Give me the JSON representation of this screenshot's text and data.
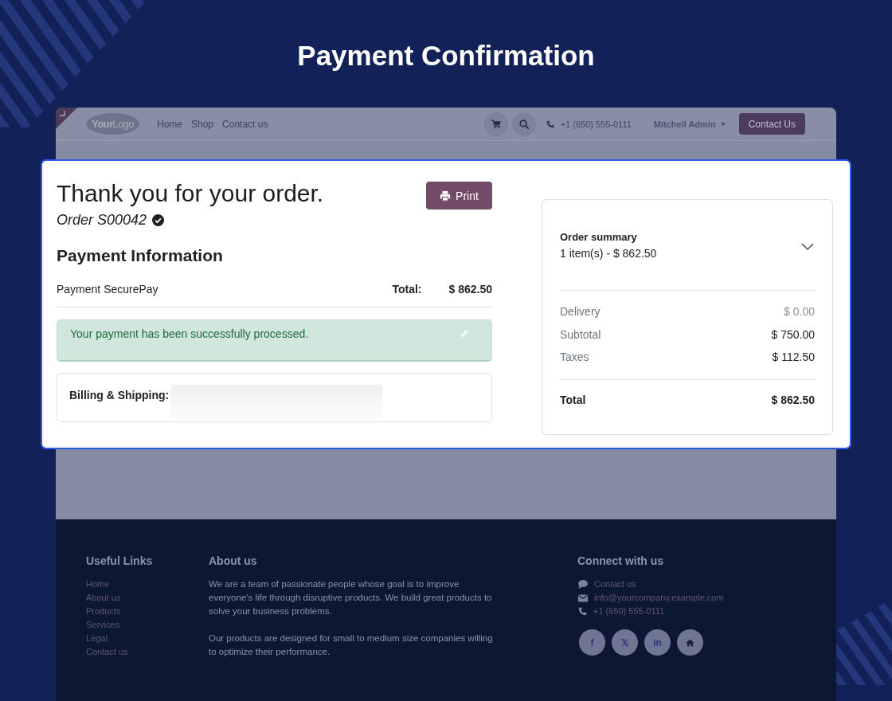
{
  "page": {
    "title": "Payment Confirmation"
  },
  "navbar": {
    "logo": "**Your**Logo",
    "links": [
      "Home",
      "Shop",
      "Contact us"
    ],
    "phone": "+1 (650) 555-0111",
    "user": "Mitchell Admin",
    "cta": "Contact Us"
  },
  "confirmation": {
    "heading": "Thank you for your order.",
    "print_button": "Print",
    "order": "Order S00042",
    "verified": true,
    "section_title": "Payment Information",
    "payment_method": "Payment SecurePay",
    "total_label": "Total:",
    "total_value": "$ 862.50",
    "alert": "Your payment has been successfully processed.",
    "billing_label": "Billing & Shipping:"
  },
  "summary": {
    "title": "Order summary",
    "subtitle": "1 item(s) - $ 862.50",
    "expanded": false,
    "rows": [
      {
        "label": "Delivery",
        "value": "$ 0.00",
        "muted": true
      },
      {
        "label": "Subtotal",
        "value": "$ 750.00",
        "muted": false
      },
      {
        "label": "Taxes",
        "value": "$ 112.50",
        "muted": false
      }
    ],
    "total": {
      "label": "Total",
      "value": "$ 862.50"
    }
  },
  "footer": {
    "links_title": "Useful Links",
    "links": [
      "Home",
      "About us",
      "Products",
      "Services",
      "Legal",
      "Contact us"
    ],
    "about_title": "About us",
    "about": [
      "We are a team of passionate people whose goal is to improve everyone's life through disruptive products. We build great products to solve your business problems.",
      "Our products are designed for small to medium size companies willing to optimize their performance."
    ],
    "connect_title": "Connect with us",
    "contacts": [
      {
        "kind": "chat",
        "text": "Contact us"
      },
      {
        "kind": "email",
        "text": "info@yourcompany.example.com"
      },
      {
        "kind": "phone",
        "text": "+1 (650) 555-0111"
      }
    ],
    "social": [
      {
        "kind": "facebook",
        "glyph": "f"
      },
      {
        "kind": "x",
        "glyph": "𝕏"
      },
      {
        "kind": "linkedin",
        "glyph": "in"
      },
      {
        "kind": "home"
      }
    ]
  }
}
